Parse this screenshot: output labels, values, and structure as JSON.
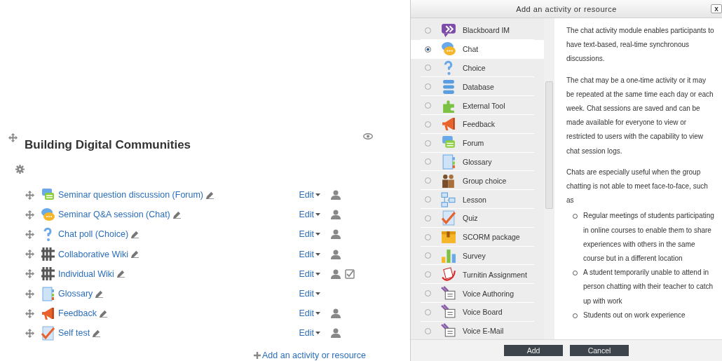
{
  "section": {
    "title": "Building Digital Communities",
    "activities": [
      {
        "kind": "forum",
        "name": "Seminar question discussion (Forum)",
        "edit": "Edit",
        "group_mode": true,
        "completion": false
      },
      {
        "kind": "chat",
        "name": "Seminar Q&A session (Chat)",
        "edit": "Edit",
        "group_mode": true,
        "completion": false
      },
      {
        "kind": "choice",
        "name": "Chat poll (Choice)",
        "edit": "Edit",
        "group_mode": true,
        "completion": false
      },
      {
        "kind": "wiki",
        "name": "Collaborative Wiki",
        "edit": "Edit",
        "group_mode": true,
        "completion": false
      },
      {
        "kind": "wiki",
        "name": "Individual Wiki",
        "edit": "Edit",
        "group_mode": true,
        "completion": true
      },
      {
        "kind": "glossary",
        "name": "Glossary",
        "edit": "Edit",
        "group_mode": false,
        "completion": false
      },
      {
        "kind": "feedback",
        "name": "Feedback",
        "edit": "Edit",
        "group_mode": true,
        "completion": false
      },
      {
        "kind": "quiz",
        "name": "Self test",
        "edit": "Edit",
        "group_mode": true,
        "completion": false
      }
    ],
    "add_link": "Add an activity or resource"
  },
  "dialog": {
    "title": "Add an activity or resource",
    "close": "x",
    "options": [
      {
        "kind": "im",
        "label": "Blackboard IM",
        "selected": false
      },
      {
        "kind": "chat",
        "label": "Chat",
        "selected": true
      },
      {
        "kind": "choice",
        "label": "Choice",
        "selected": false
      },
      {
        "kind": "database",
        "label": "Database",
        "selected": false
      },
      {
        "kind": "tool",
        "label": "External Tool",
        "selected": false
      },
      {
        "kind": "feedback",
        "label": "Feedback",
        "selected": false
      },
      {
        "kind": "forum",
        "label": "Forum",
        "selected": false
      },
      {
        "kind": "glossary",
        "label": "Glossary",
        "selected": false
      },
      {
        "kind": "group",
        "label": "Group choice",
        "selected": false
      },
      {
        "kind": "lesson",
        "label": "Lesson",
        "selected": false
      },
      {
        "kind": "quiz",
        "label": "Quiz",
        "selected": false
      },
      {
        "kind": "scorm",
        "label": "SCORM package",
        "selected": false
      },
      {
        "kind": "survey",
        "label": "Survey",
        "selected": false
      },
      {
        "kind": "turnitin",
        "label": "Turnitin Assignment",
        "selected": false
      },
      {
        "kind": "voice",
        "label": "Voice Authoring",
        "selected": false
      },
      {
        "kind": "voice",
        "label": "Voice Board",
        "selected": false
      },
      {
        "kind": "voice",
        "label": "Voice E-Mail",
        "selected": false
      }
    ],
    "description": {
      "paragraphs": [
        "The chat activity module enables participants to have text-based, real-time synchronous discussions.",
        "The chat may be a one-time activity or it may be repeated at the same time each day or each week. Chat sessions are saved and can be made available for everyone to view or restricted to users with the capability to view chat session logs.",
        "Chats are especially useful when the group chatting is not able to meet face-to-face, such as"
      ],
      "bullets": [
        "Regular meetings of students participating in online courses to enable them to share experiences with others in the same course but in a different location",
        "A student temporarily unable to attend in person chatting with their teacher to catch up with work",
        "Students out on work experience"
      ]
    },
    "buttons": [
      "Add",
      "Cancel"
    ]
  }
}
